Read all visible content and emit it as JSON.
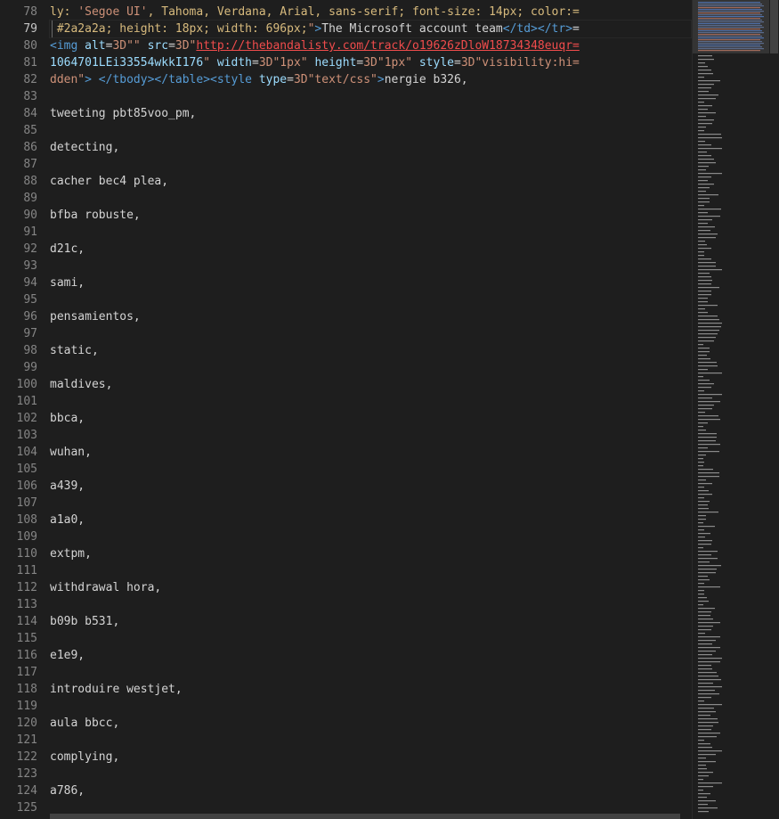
{
  "editor": {
    "active_line": "79",
    "lines": [
      {
        "n": "78",
        "tokens": [
          {
            "c": "prop",
            "t": "ly: "
          },
          {
            "c": "str",
            "t": "'Segoe UI'"
          },
          {
            "c": "prop",
            "t": ", Tahoma, Verdana, Arial, sans-serif; font-size: 14px; color:="
          }
        ]
      },
      {
        "n": "79",
        "tokens": [
          {
            "c": "prop",
            "t": " #2a2a2a; height: 18px; width: 696px;"
          },
          {
            "c": "str",
            "t": "\""
          },
          {
            "c": "tag",
            "t": ">"
          },
          {
            "c": "plain",
            "t": "The Microsoft account team"
          },
          {
            "c": "tag",
            "t": "</td></tr>"
          },
          {
            "c": "plain",
            "t": "="
          }
        ]
      },
      {
        "n": "80",
        "tokens": [
          {
            "c": "tag",
            "t": "<img "
          },
          {
            "c": "attr",
            "t": "alt"
          },
          {
            "c": "plain",
            "t": "="
          },
          {
            "c": "str",
            "t": "3D\"\""
          },
          {
            "c": "plain",
            "t": " "
          },
          {
            "c": "attr",
            "t": "src"
          },
          {
            "c": "plain",
            "t": "="
          },
          {
            "c": "str",
            "t": "3D\""
          },
          {
            "c": "url",
            "t": "http://thebandalisty.com/track/o19626zDloW18734348euqr="
          }
        ]
      },
      {
        "n": "81",
        "tokens": [
          {
            "c": "attr",
            "t": "1064701LEi33554wkkI176"
          },
          {
            "c": "str",
            "t": "\""
          },
          {
            "c": "plain",
            "t": " "
          },
          {
            "c": "attr",
            "t": "width"
          },
          {
            "c": "plain",
            "t": "="
          },
          {
            "c": "str",
            "t": "3D\"1px\""
          },
          {
            "c": "plain",
            "t": " "
          },
          {
            "c": "attr",
            "t": "height"
          },
          {
            "c": "plain",
            "t": "="
          },
          {
            "c": "str",
            "t": "3D\"1px\""
          },
          {
            "c": "plain",
            "t": " "
          },
          {
            "c": "attr",
            "t": "style"
          },
          {
            "c": "plain",
            "t": "="
          },
          {
            "c": "str",
            "t": "3D\"visibility:hi="
          }
        ]
      },
      {
        "n": "82",
        "tokens": [
          {
            "c": "str",
            "t": "dden\""
          },
          {
            "c": "tag",
            "t": ">"
          },
          {
            "c": "plain",
            "t": " "
          },
          {
            "c": "tag",
            "t": "</tbody></table><style "
          },
          {
            "c": "attr",
            "t": "type"
          },
          {
            "c": "plain",
            "t": "="
          },
          {
            "c": "str",
            "t": "3D\"text/css\""
          },
          {
            "c": "tag",
            "t": ">"
          },
          {
            "c": "plain",
            "t": "nergie b326,"
          }
        ]
      },
      {
        "n": "83",
        "tokens": []
      },
      {
        "n": "84",
        "tokens": [
          {
            "c": "plain",
            "t": "tweeting pbt85voo_pm,"
          }
        ]
      },
      {
        "n": "85",
        "tokens": []
      },
      {
        "n": "86",
        "tokens": [
          {
            "c": "plain",
            "t": "detecting,"
          }
        ]
      },
      {
        "n": "87",
        "tokens": []
      },
      {
        "n": "88",
        "tokens": [
          {
            "c": "plain",
            "t": "cacher bec4 plea,"
          }
        ]
      },
      {
        "n": "89",
        "tokens": []
      },
      {
        "n": "90",
        "tokens": [
          {
            "c": "plain",
            "t": "bfba robuste,"
          }
        ]
      },
      {
        "n": "91",
        "tokens": []
      },
      {
        "n": "92",
        "tokens": [
          {
            "c": "plain",
            "t": "d21c,"
          }
        ]
      },
      {
        "n": "93",
        "tokens": []
      },
      {
        "n": "94",
        "tokens": [
          {
            "c": "plain",
            "t": "sami,"
          }
        ]
      },
      {
        "n": "95",
        "tokens": []
      },
      {
        "n": "96",
        "tokens": [
          {
            "c": "plain",
            "t": "pensamientos,"
          }
        ]
      },
      {
        "n": "97",
        "tokens": []
      },
      {
        "n": "98",
        "tokens": [
          {
            "c": "plain",
            "t": "static,"
          }
        ]
      },
      {
        "n": "99",
        "tokens": []
      },
      {
        "n": "100",
        "tokens": [
          {
            "c": "plain",
            "t": "maldives,"
          }
        ]
      },
      {
        "n": "101",
        "tokens": []
      },
      {
        "n": "102",
        "tokens": [
          {
            "c": "plain",
            "t": "bbca,"
          }
        ]
      },
      {
        "n": "103",
        "tokens": []
      },
      {
        "n": "104",
        "tokens": [
          {
            "c": "plain",
            "t": "wuhan,"
          }
        ]
      },
      {
        "n": "105",
        "tokens": []
      },
      {
        "n": "106",
        "tokens": [
          {
            "c": "plain",
            "t": "a439,"
          }
        ]
      },
      {
        "n": "107",
        "tokens": []
      },
      {
        "n": "108",
        "tokens": [
          {
            "c": "plain",
            "t": "a1a0,"
          }
        ]
      },
      {
        "n": "109",
        "tokens": []
      },
      {
        "n": "110",
        "tokens": [
          {
            "c": "plain",
            "t": "extpm,"
          }
        ]
      },
      {
        "n": "111",
        "tokens": []
      },
      {
        "n": "112",
        "tokens": [
          {
            "c": "plain",
            "t": "withdrawal hora,"
          }
        ]
      },
      {
        "n": "113",
        "tokens": []
      },
      {
        "n": "114",
        "tokens": [
          {
            "c": "plain",
            "t": "b09b b531,"
          }
        ]
      },
      {
        "n": "115",
        "tokens": []
      },
      {
        "n": "116",
        "tokens": [
          {
            "c": "plain",
            "t": "e1e9,"
          }
        ]
      },
      {
        "n": "117",
        "tokens": []
      },
      {
        "n": "118",
        "tokens": [
          {
            "c": "plain",
            "t": "introduire westjet,"
          }
        ]
      },
      {
        "n": "119",
        "tokens": []
      },
      {
        "n": "120",
        "tokens": [
          {
            "c": "plain",
            "t": "aula bbcc,"
          }
        ]
      },
      {
        "n": "121",
        "tokens": []
      },
      {
        "n": "122",
        "tokens": [
          {
            "c": "plain",
            "t": "complying,"
          }
        ]
      },
      {
        "n": "123",
        "tokens": []
      },
      {
        "n": "124",
        "tokens": [
          {
            "c": "plain",
            "t": "a786,"
          }
        ]
      },
      {
        "n": "125",
        "tokens": []
      }
    ]
  },
  "colors": {
    "background": "#1e1e1e",
    "line_number": "#858585",
    "active_line_number": "#c6c6c6",
    "text": "#d4d4d4",
    "css_property": "#d7ba7d",
    "string": "#ce9178",
    "tag": "#569cd6",
    "attribute": "#9cdcfe",
    "link": "#f14c4c"
  }
}
